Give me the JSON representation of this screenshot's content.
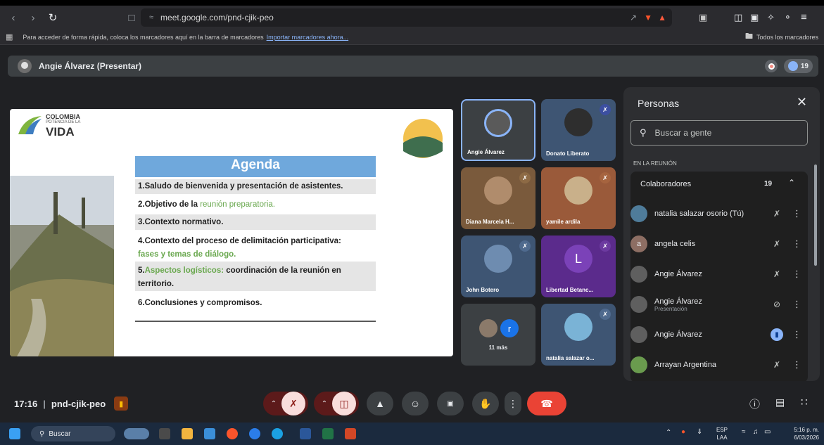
{
  "browser": {
    "url": "meet.google.com/pnd-cjik-peo",
    "bookmarks_text": "Para acceder de forma rápida, coloca los marcadores aquí en la barra de marcadores",
    "bookmarks_link": "Importar marcadores ahora...",
    "all_bookmarks": "Todos los marcadores"
  },
  "meeting": {
    "presenter_label": "Angie Álvarez (Presentar)",
    "participant_count": "19",
    "time": "17:16",
    "code": "pnd-cjik-peo"
  },
  "slide": {
    "logo_line1": "COLOMBIA",
    "logo_line2": "POTENCIA DE LA",
    "logo_line3": "VIDA",
    "agenda_title": "Agenda",
    "items": [
      {
        "num": "1.",
        "text": "Saludo de bienvenida y presentación de asistentes.",
        "green": ""
      },
      {
        "num": "2.",
        "text": "Objetivo de la ",
        "green": "reunión preparatoria."
      },
      {
        "num": "3.",
        "text": "Contexto normativo.",
        "green": ""
      },
      {
        "num": "4.",
        "text": "Contexto del proceso de delimitación participativa:",
        "green": "fases y temas de diálogo."
      },
      {
        "num": "5.",
        "green_first": "Aspectos logísticos:",
        "text": " coordinación de la reunión en territorio."
      },
      {
        "num": "6.",
        "text": "Conclusiones y compromisos.",
        "green": ""
      }
    ]
  },
  "tiles": [
    {
      "name": "Angie Álvarez",
      "muted": false
    },
    {
      "name": "Donato Liberato",
      "muted": true
    },
    {
      "name": "Diana Marcela H...",
      "muted": true
    },
    {
      "name": "yamile ardila",
      "muted": true
    },
    {
      "name": "John Botero",
      "muted": true
    },
    {
      "name": "Libertad Betanc...",
      "muted": true,
      "initial": "L"
    },
    {
      "name": "11 más",
      "initial": "r"
    },
    {
      "name": "natalia salazar o...",
      "muted": true
    }
  ],
  "people_panel": {
    "title": "Personas",
    "search_placeholder": "Buscar a gente",
    "section": "EN LA REUNIÓN",
    "group": "Colaboradores",
    "group_count": "19",
    "members": [
      {
        "name": "natalia salazar osorio (Tú)",
        "sub": ""
      },
      {
        "name": "angela celis",
        "sub": "",
        "initial": "a"
      },
      {
        "name": "Angie Álvarez",
        "sub": ""
      },
      {
        "name": "Angie Álvarez",
        "sub": "Presentación"
      },
      {
        "name": "Angie Álvarez",
        "sub": ""
      },
      {
        "name": "Arrayan Argentina",
        "sub": ""
      }
    ]
  },
  "taskbar": {
    "search": "Buscar",
    "lang1": "ESP",
    "lang2": "LAA",
    "clock": "5:16 p. m.",
    "date": "6/03/2026"
  },
  "colors": {
    "accent_blue": "#8ab4f8",
    "leave_red": "#ea4335",
    "agenda_header": "#6fa8dc",
    "green_text": "#6aa84f"
  }
}
